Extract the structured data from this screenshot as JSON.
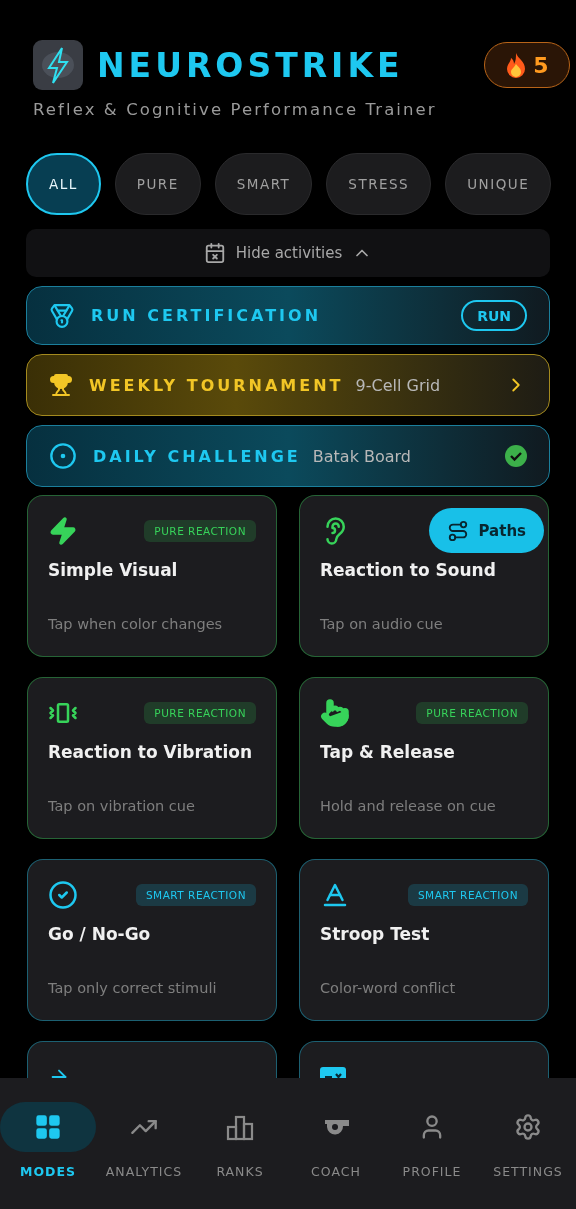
{
  "header": {
    "title": "NEUROSTRIKE",
    "subtitle": "Reflex & Cognitive Performance Trainer",
    "streak": "5"
  },
  "filters": [
    {
      "label": "ALL",
      "selected": true
    },
    {
      "label": "PURE",
      "selected": false
    },
    {
      "label": "SMART",
      "selected": false
    },
    {
      "label": "STRESS",
      "selected": false
    },
    {
      "label": "UNIQUE",
      "selected": false
    }
  ],
  "activities_toggle": {
    "label": "Hide activities",
    "expanded": true
  },
  "banners": [
    {
      "kind": "certification",
      "title": "RUN CERTIFICATION",
      "action": "RUN"
    },
    {
      "kind": "tournament",
      "title": "WEEKLY TOURNAMENT",
      "detail": "9-Cell Grid"
    },
    {
      "kind": "daily",
      "title": "DAILY CHALLENGE",
      "detail": "Batak Board",
      "done": true
    }
  ],
  "modes": [
    {
      "kind": "bolt",
      "color": "#37d35a",
      "tag": "PURE REACTION",
      "title": "Simple Visual",
      "description": "Tap when color changes"
    },
    {
      "kind": "ear",
      "color": "#37d35a",
      "title": "Reaction to Sound",
      "description": "Tap on audio cue"
    },
    {
      "kind": "vibrate",
      "color": "#37d35a",
      "tag": "PURE REACTION",
      "title": "Reaction to Vibration",
      "description": "Tap on vibration cue"
    },
    {
      "kind": "hand",
      "color": "#37d35a",
      "tag": "PURE REACTION",
      "title": "Tap & Release",
      "description": "Hold and release on cue"
    },
    {
      "kind": "check",
      "color": "#1ec8f0",
      "tag": "SMART REACTION",
      "title": "Go / No-Go",
      "description": "Tap only correct stimuli"
    },
    {
      "kind": "letter",
      "color": "#1ec8f0",
      "tag": "SMART REACTION",
      "title": "Stroop Test",
      "description": "Color-word conflict"
    },
    {
      "kind": "arrow",
      "color": "#1ec8f0"
    },
    {
      "kind": "card",
      "color": "#1ec8f0"
    }
  ],
  "paths_button": {
    "label": "Paths"
  },
  "nav": [
    {
      "label": "MODES",
      "kind": "grid",
      "selected": true
    },
    {
      "label": "ANALYTICS",
      "kind": "trend",
      "selected": false
    },
    {
      "label": "RANKS",
      "kind": "podium",
      "selected": false
    },
    {
      "label": "COACH",
      "kind": "whistle",
      "selected": false
    },
    {
      "label": "PROFILE",
      "kind": "user",
      "selected": false
    },
    {
      "label": "SETTINGS",
      "kind": "gear",
      "selected": false
    }
  ]
}
